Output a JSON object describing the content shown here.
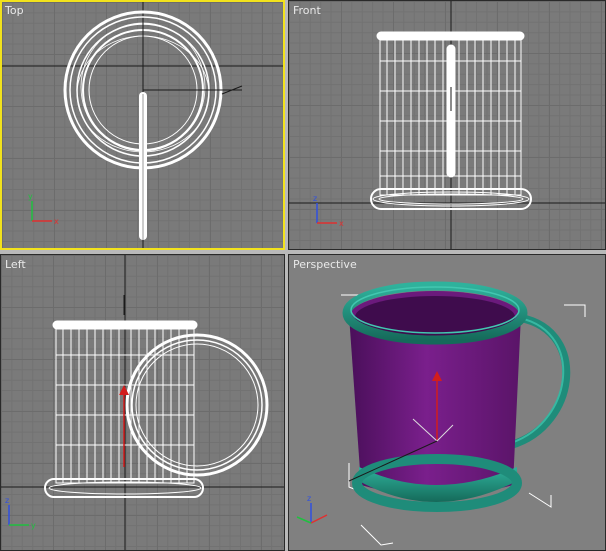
{
  "viewports": {
    "top": {
      "label": "Top"
    },
    "front": {
      "label": "Front"
    },
    "left": {
      "label": "Left"
    },
    "perspective": {
      "label": "Perspective"
    }
  },
  "axis_labels": {
    "x": "x",
    "y": "y",
    "z": "z"
  },
  "colors": {
    "active_border": "#f2e21c",
    "wire": "#ffffff",
    "mug_body": "#6d1a7e",
    "mug_rim": "#1f8c7a",
    "gizmo_red": "#d21d1d"
  },
  "icons": [
    "axis-tripod-icon",
    "transform-gizmo-icon"
  ]
}
